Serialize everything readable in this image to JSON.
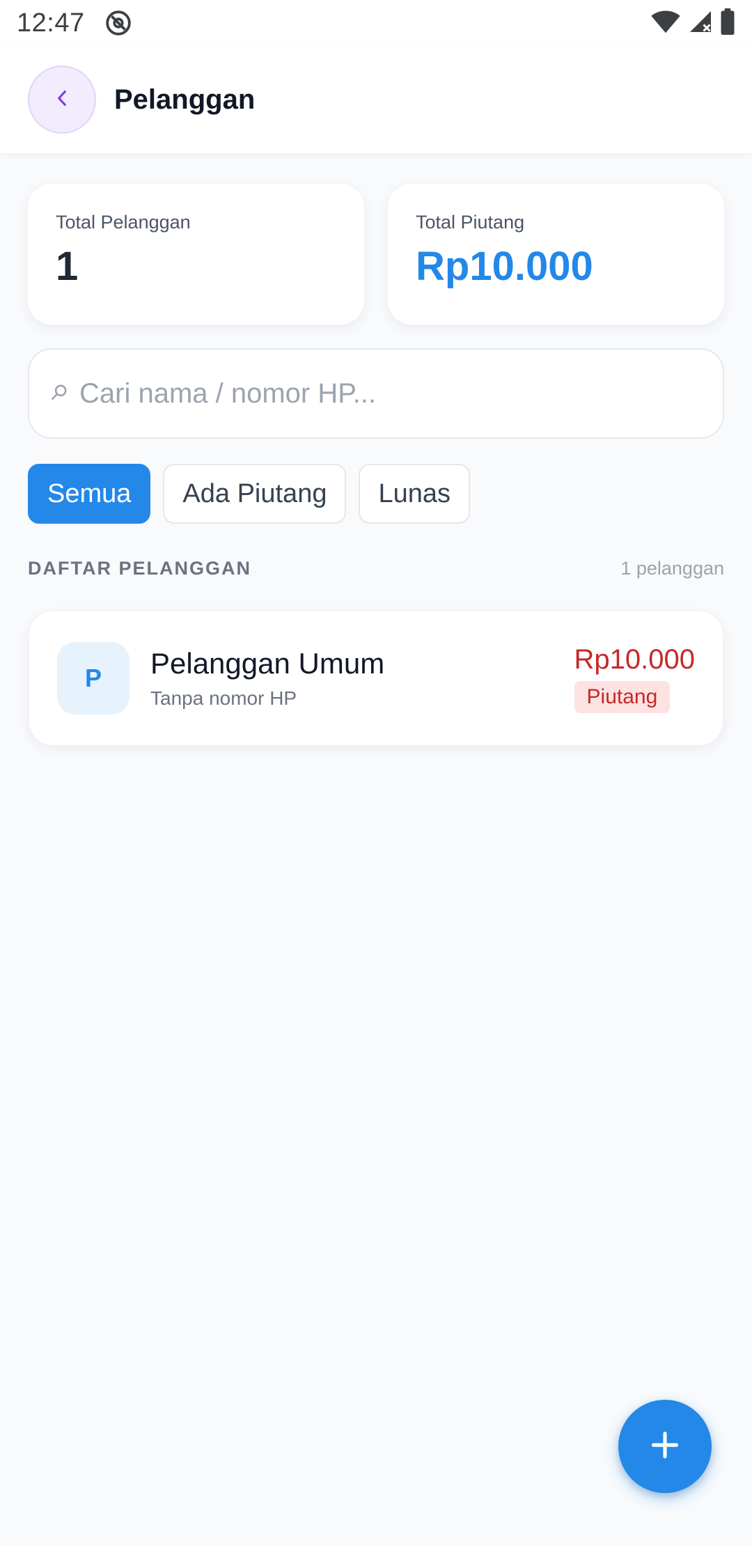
{
  "status_bar": {
    "time": "12:47",
    "icons": [
      "at-sign-icon",
      "wifi-icon",
      "signal-icon",
      "battery-icon"
    ]
  },
  "header": {
    "title": "Pelanggan",
    "back_icon": "chevron-left-icon"
  },
  "summary": {
    "total_customers_label": "Total Pelanggan",
    "total_customers_value": "1",
    "total_receivable_label": "Total Piutang",
    "total_receivable_value": "Rp10.000"
  },
  "search": {
    "placeholder": "Cari nama / nomor HP...",
    "value": "",
    "icon": "search-icon"
  },
  "filters": [
    {
      "label": "Semua",
      "active": true
    },
    {
      "label": "Ada Piutang",
      "active": false
    },
    {
      "label": "Lunas",
      "active": false
    }
  ],
  "list": {
    "title": "DAFTAR PELANGGAN",
    "count_text": "1 pelanggan",
    "items": [
      {
        "initial": "P",
        "name": "Pelanggan Umum",
        "subtitle": "Tanpa nomor HP",
        "amount": "Rp10.000",
        "status": "Piutang"
      }
    ]
  },
  "fab": {
    "icon": "plus-icon"
  },
  "colors": {
    "accent": "#2388e8",
    "danger": "#c62828",
    "danger_bg": "#fde2e2",
    "back_button_bg": "#f3ecfd",
    "back_button_icon": "#7c3aed",
    "background": "#f8fafc"
  }
}
